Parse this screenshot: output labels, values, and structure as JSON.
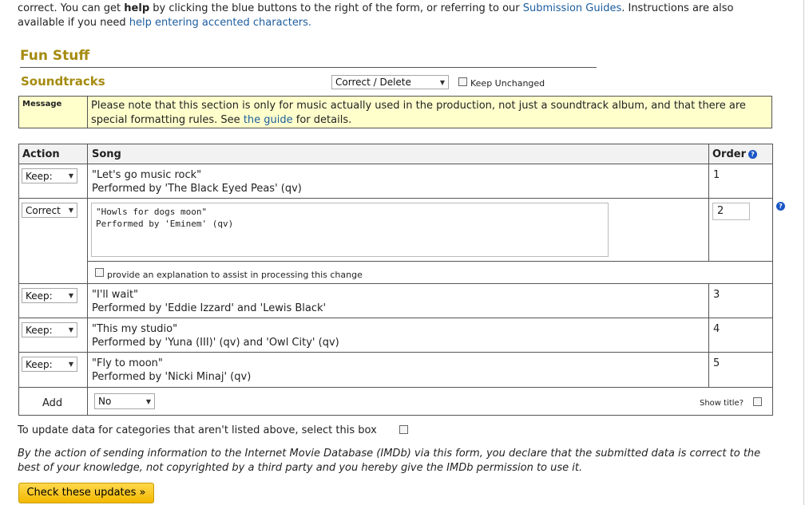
{
  "intro": {
    "line1_a": "correct. You can get ",
    "line1_help": "help",
    "line1_b": " by clicking the blue buttons to the right of the form, or referring to our ",
    "line1_link": "Submission Guides",
    "line1_c": ". Instructions are also",
    "line2_a": "available if you need ",
    "line2_link": "help entering accented characters."
  },
  "section": {
    "title": "Fun Stuff"
  },
  "soundtracks": {
    "title": "Soundtracks",
    "action_select": "Correct / Delete",
    "keep_unchanged_label": "Keep Unchanged"
  },
  "message": {
    "label": "Message",
    "text_a": "Please note that this section is only for music actually used in the production, not just a soundtrack album, and that there are special formatting rules. See ",
    "link": "the guide",
    "text_b": " for details."
  },
  "table": {
    "headers": {
      "action": "Action",
      "song": "Song",
      "order": "Order"
    },
    "rows": [
      {
        "action": "Keep:",
        "title": "\"Let's go music rock\"",
        "performer": "Performed by 'The Black Eyed Peas' (qv)",
        "order": "1"
      },
      {
        "action": "Correct",
        "textarea": "\"Howls for dogs moon\"\nPerformed by 'Eminem' (qv)",
        "order": "2",
        "explain_label": "provide an explanation to assist in processing this change"
      },
      {
        "action": "Keep:",
        "title": "\"I'll wait\"",
        "performer": "Performed by 'Eddie Izzard' and 'Lewis Black'",
        "order": "3"
      },
      {
        "action": "Keep:",
        "title": "\"This my studio\"",
        "performer": "Performed by 'Yuna (III)' (qv) and 'Owl City' (qv)",
        "order": "4"
      },
      {
        "action": "Keep:",
        "title": "\"Fly to moon\"",
        "performer": "Performed by 'Nicki Minaj' (qv)",
        "order": "5"
      }
    ],
    "add": {
      "label": "Add",
      "select": "No",
      "show_title_label": "Show title?"
    }
  },
  "footer": {
    "update_label": "To update data for categories that aren't listed above, select this box",
    "disclaimer": "By the action of sending information to the Internet Movie Database (IMDb) via this form, you declare that the submitted data is correct to the best of your knowledge, not copyrighted by a third party and you hereby give the IMDb permission to use it.",
    "submit_label": "Check these updates »"
  },
  "colors": {
    "section_title": "#a58b10",
    "message_bg": "#ffffcc",
    "link": "#1d5d9e",
    "help_icon": "#1a55c4",
    "button": "#f3b900"
  }
}
